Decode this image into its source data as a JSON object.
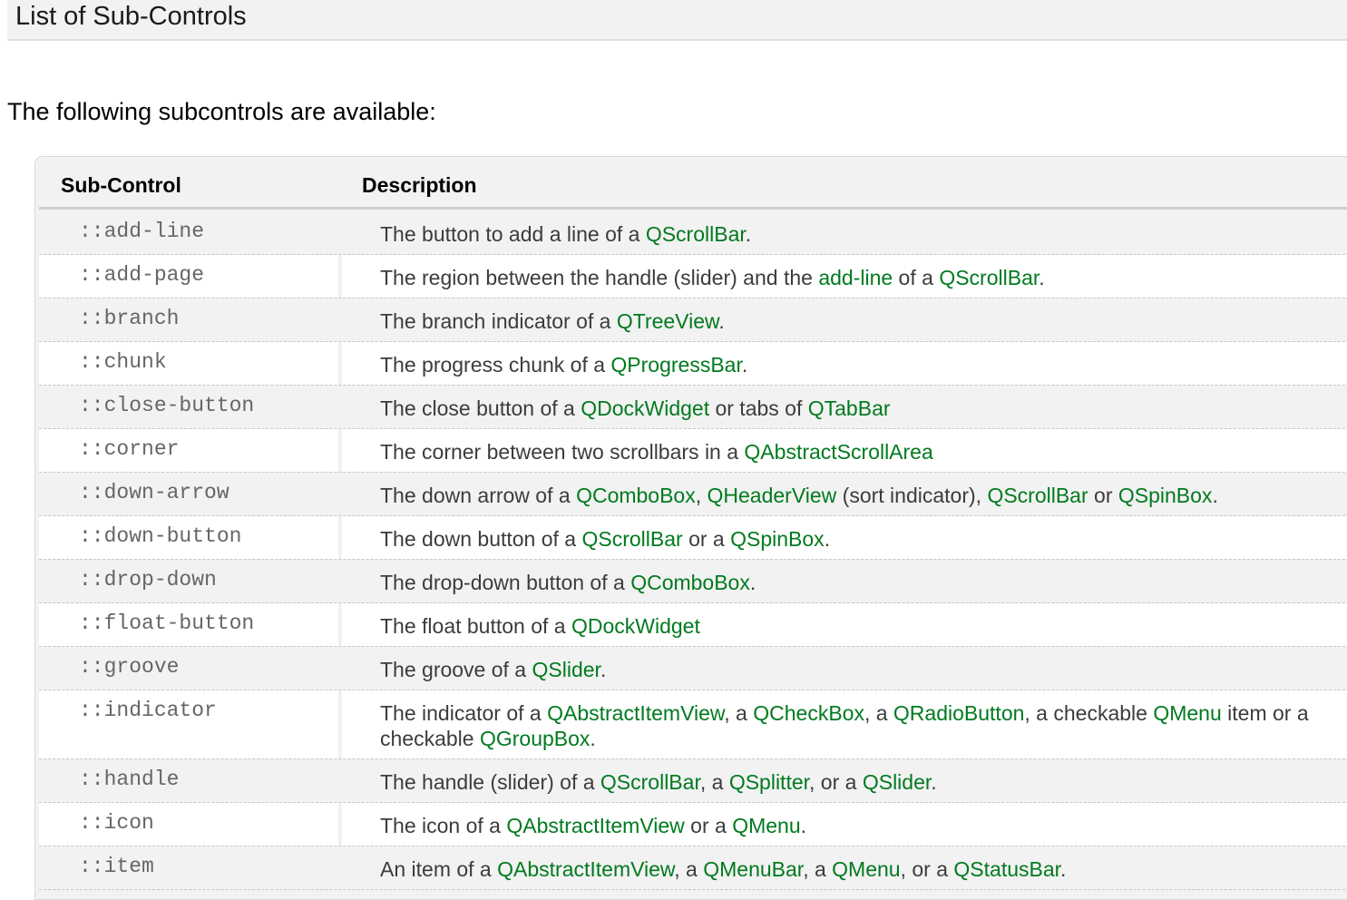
{
  "section": {
    "title": "List of Sub-Controls"
  },
  "intro": "The following subcontrols are available:",
  "table": {
    "headers": {
      "sub_control": "Sub-Control",
      "description": "Description"
    },
    "link_color": "#007a1f",
    "rows": [
      {
        "name": "::add-line",
        "desc": [
          {
            "t": "The button to add a line of a "
          },
          {
            "l": "QScrollBar"
          },
          {
            "t": "."
          }
        ]
      },
      {
        "name": "::add-page",
        "desc": [
          {
            "t": "The region between the handle (slider) and the "
          },
          {
            "l": "add-line"
          },
          {
            "t": " of a "
          },
          {
            "l": "QScrollBar"
          },
          {
            "t": "."
          }
        ]
      },
      {
        "name": "::branch",
        "desc": [
          {
            "t": "The branch indicator of a "
          },
          {
            "l": "QTreeView"
          },
          {
            "t": "."
          }
        ]
      },
      {
        "name": "::chunk",
        "desc": [
          {
            "t": "The progress chunk of a "
          },
          {
            "l": "QProgressBar"
          },
          {
            "t": "."
          }
        ]
      },
      {
        "name": "::close-button",
        "desc": [
          {
            "t": "The close button of a "
          },
          {
            "l": "QDockWidget"
          },
          {
            "t": " or tabs of "
          },
          {
            "l": "QTabBar"
          }
        ]
      },
      {
        "name": "::corner",
        "desc": [
          {
            "t": "The corner between two scrollbars in a "
          },
          {
            "l": "QAbstractScrollArea"
          }
        ]
      },
      {
        "name": "::down-arrow",
        "desc": [
          {
            "t": "The down arrow of a "
          },
          {
            "l": "QComboBox"
          },
          {
            "t": ", "
          },
          {
            "l": "QHeaderView"
          },
          {
            "t": " (sort indicator), "
          },
          {
            "l": "QScrollBar"
          },
          {
            "t": " or "
          },
          {
            "l": "QSpinBox"
          },
          {
            "t": "."
          }
        ]
      },
      {
        "name": "::down-button",
        "desc": [
          {
            "t": "The down button of a "
          },
          {
            "l": "QScrollBar"
          },
          {
            "t": " or a "
          },
          {
            "l": "QSpinBox"
          },
          {
            "t": "."
          }
        ]
      },
      {
        "name": "::drop-down",
        "desc": [
          {
            "t": "The drop-down button of a "
          },
          {
            "l": "QComboBox"
          },
          {
            "t": "."
          }
        ]
      },
      {
        "name": "::float-button",
        "desc": [
          {
            "t": "The float button of a "
          },
          {
            "l": "QDockWidget"
          }
        ]
      },
      {
        "name": "::groove",
        "desc": [
          {
            "t": "The groove of a "
          },
          {
            "l": "QSlider"
          },
          {
            "t": "."
          }
        ]
      },
      {
        "name": "::indicator",
        "tall": true,
        "desc": [
          {
            "t": "The indicator of a "
          },
          {
            "l": "QAbstractItemView"
          },
          {
            "t": ", a "
          },
          {
            "l": "QCheckBox"
          },
          {
            "t": ", a "
          },
          {
            "l": "QRadioButton"
          },
          {
            "t": ", a checkable "
          },
          {
            "l": "QMenu"
          },
          {
            "t": " item or a checkable "
          },
          {
            "l": "QGroupBox"
          },
          {
            "t": "."
          }
        ]
      },
      {
        "name": "::handle",
        "desc": [
          {
            "t": "The handle (slider) of a "
          },
          {
            "l": "QScrollBar"
          },
          {
            "t": ", a "
          },
          {
            "l": "QSplitter"
          },
          {
            "t": ", or a "
          },
          {
            "l": "QSlider"
          },
          {
            "t": "."
          }
        ]
      },
      {
        "name": "::icon",
        "desc": [
          {
            "t": "The icon of a "
          },
          {
            "l": "QAbstractItemView"
          },
          {
            "t": " or a "
          },
          {
            "l": "QMenu"
          },
          {
            "t": "."
          }
        ]
      },
      {
        "name": "::item",
        "desc": [
          {
            "t": "An item of a "
          },
          {
            "l": "QAbstractItemView"
          },
          {
            "t": ", a "
          },
          {
            "l": "QMenuBar"
          },
          {
            "t": ", a "
          },
          {
            "l": "QMenu"
          },
          {
            "t": ", or a "
          },
          {
            "l": "QStatusBar"
          },
          {
            "t": "."
          }
        ]
      }
    ]
  }
}
